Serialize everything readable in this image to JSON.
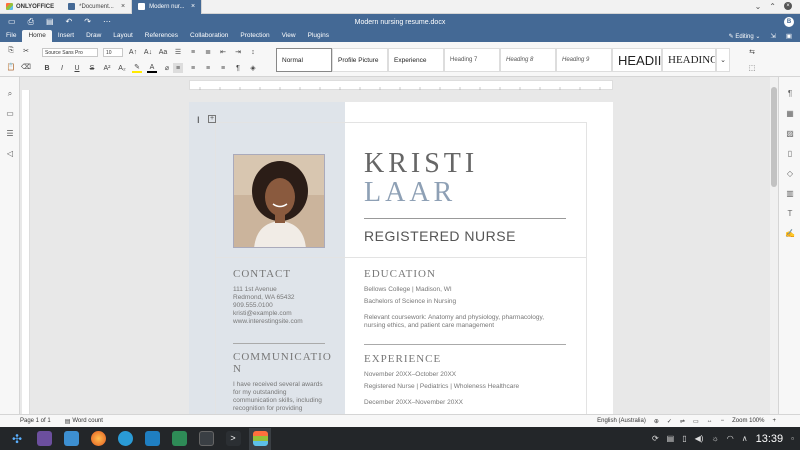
{
  "app": {
    "brand": "ONLYOFFICE",
    "tabs": [
      {
        "label": "*Document..."
      },
      {
        "label": "Modern nur..."
      }
    ],
    "title": "Modern nursing resume.docx",
    "user_initial": "B"
  },
  "menu": {
    "tabs": [
      "File",
      "Home",
      "Insert",
      "Draw",
      "Layout",
      "References",
      "Collaboration",
      "Protection",
      "View",
      "Plugins"
    ],
    "active": "Home",
    "editing_label": "Editing"
  },
  "toolbar": {
    "font_name": "Source Sans Pro",
    "font_size": "10",
    "styles": [
      "Normal",
      "Profile Picture",
      "Experience",
      "Heading 7",
      "Heading 8",
      "Heading 9",
      "HEADII",
      "HEADINC"
    ]
  },
  "document": {
    "name_first": "KRISTI",
    "name_last": "LAAR",
    "role": "REGISTERED NURSE",
    "contact": {
      "heading": "CONTACT",
      "lines": [
        "111 1st Avenue",
        "Redmond, WA 65432",
        "909.555.0100",
        "kristi@example.com",
        "www.interestingsite.com"
      ]
    },
    "communication": {
      "heading_1": "COMMUNICATIO",
      "heading_2": "N",
      "lines": [
        "I have received several awards",
        "for my outstanding",
        "communication skills, including",
        "recognition for providing"
      ]
    },
    "education": {
      "heading": "EDUCATION",
      "school": "Bellows College | Madison, WI",
      "degree": "Bachelors of Science in Nursing",
      "coursework_1": "Relevant coursework: Anatomy and physiology, pharmacology,",
      "coursework_2": "nursing ethics, and patient care management"
    },
    "experience": {
      "heading": "EXPERIENCE",
      "dates_1": "November 20XX–October 20XX",
      "role_1": "Registered Nurse | Pediatrics | Wholeness Healthcare",
      "dates_2": "December 20XX–November 20XX"
    }
  },
  "status": {
    "page": "Page 1 of 1",
    "word_count": "Word count",
    "language": "English (Australia)",
    "zoom": "Zoom 100%"
  },
  "taskbar": {
    "time": "13:39"
  }
}
